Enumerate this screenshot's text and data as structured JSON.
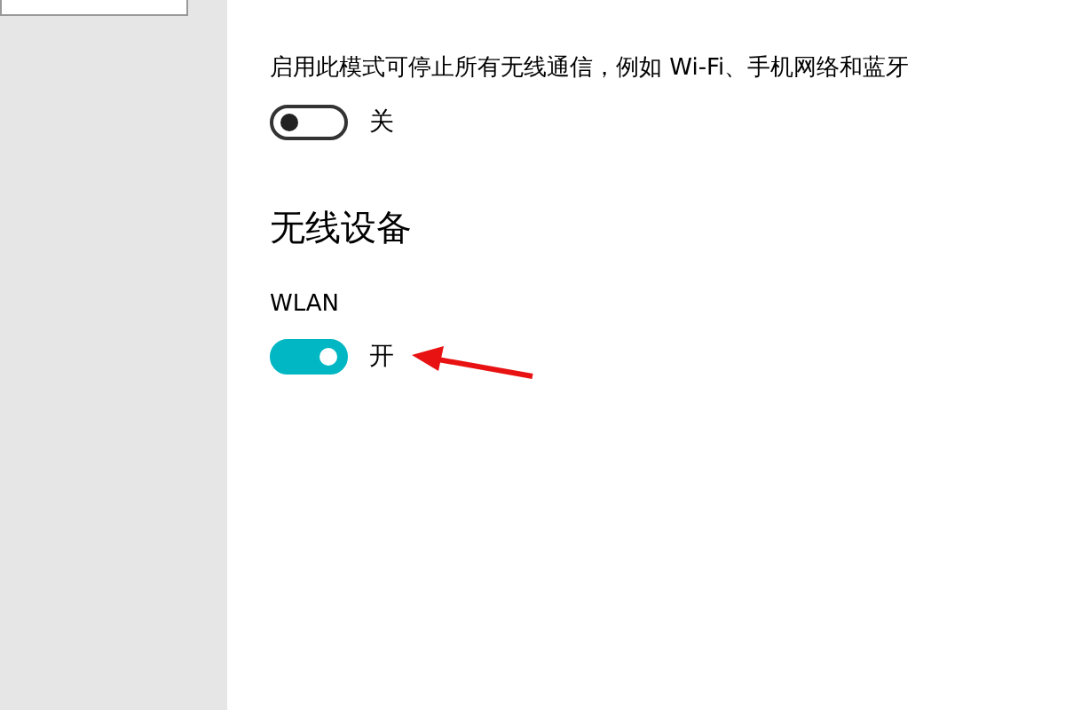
{
  "airplane_mode": {
    "description": "启用此模式可停止所有无线通信，例如 Wi-Fi、手机网络和蓝牙",
    "toggle": {
      "on": false,
      "label": "关"
    }
  },
  "wireless_devices": {
    "heading": "无线设备",
    "devices": [
      {
        "name": "WLAN",
        "on": true,
        "label": "开"
      }
    ]
  }
}
